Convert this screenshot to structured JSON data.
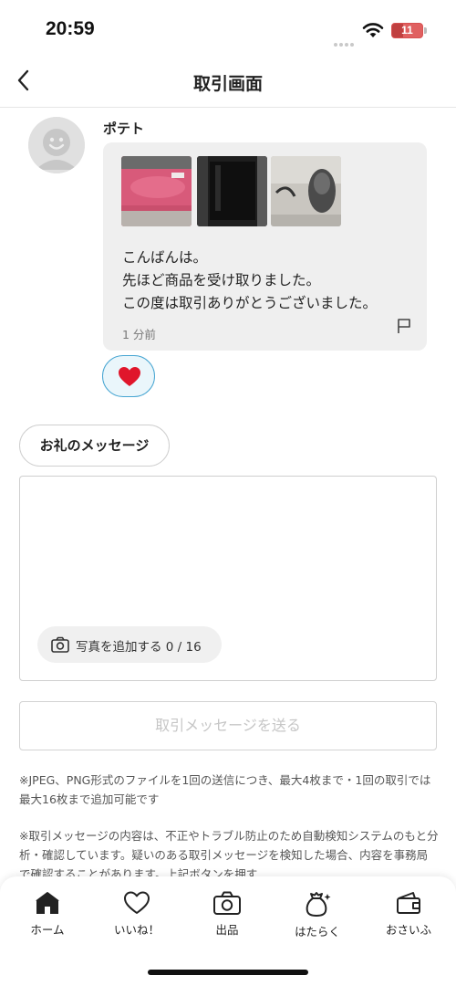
{
  "status_bar": {
    "time": "20:59",
    "battery_level": "11",
    "battery_color": "#e06060"
  },
  "header": {
    "back_icon": "chevron-left-icon",
    "title": "取引画面"
  },
  "message": {
    "sender": "ポテト",
    "avatar_icon": "default-avatar-icon",
    "photo_count": 3,
    "lines": [
      "こんばんは。",
      "先ほど商品を受け取りました。",
      "この度は取引ありがとうございました。"
    ],
    "time": "1 分前",
    "report_icon": "flag-icon",
    "reaction_icon": "heart-icon",
    "reaction_color": "#e0162b"
  },
  "compose": {
    "thanks_button": "お礼のメッセージ",
    "message_value": "",
    "add_photo_label": "写真を追加する 0 / 16",
    "send_button": "取引メッセージを送る"
  },
  "notes": {
    "note1": "※JPEG、PNG形式のファイルを1回の送信につき、最大4枚まで・1回の取引では最大16枚まで追加可能です",
    "note2": "※取引メッセージの内容は、不正やトラブル防止のため自動検知システムのもと分析・確認しています。疑いのある取引メッセージを検知した場合、内容を事務局で確認することがあります。上記ボタンを押す"
  },
  "nav": {
    "items": [
      {
        "label": "ホーム",
        "icon": "home-icon",
        "active": true
      },
      {
        "label": "いいね！",
        "icon": "heart-outline-icon"
      },
      {
        "label": "出品",
        "icon": "camera-icon"
      },
      {
        "label": "はたらく",
        "icon": "money-bag-icon"
      },
      {
        "label": "おさいふ",
        "icon": "wallet-icon"
      }
    ]
  }
}
